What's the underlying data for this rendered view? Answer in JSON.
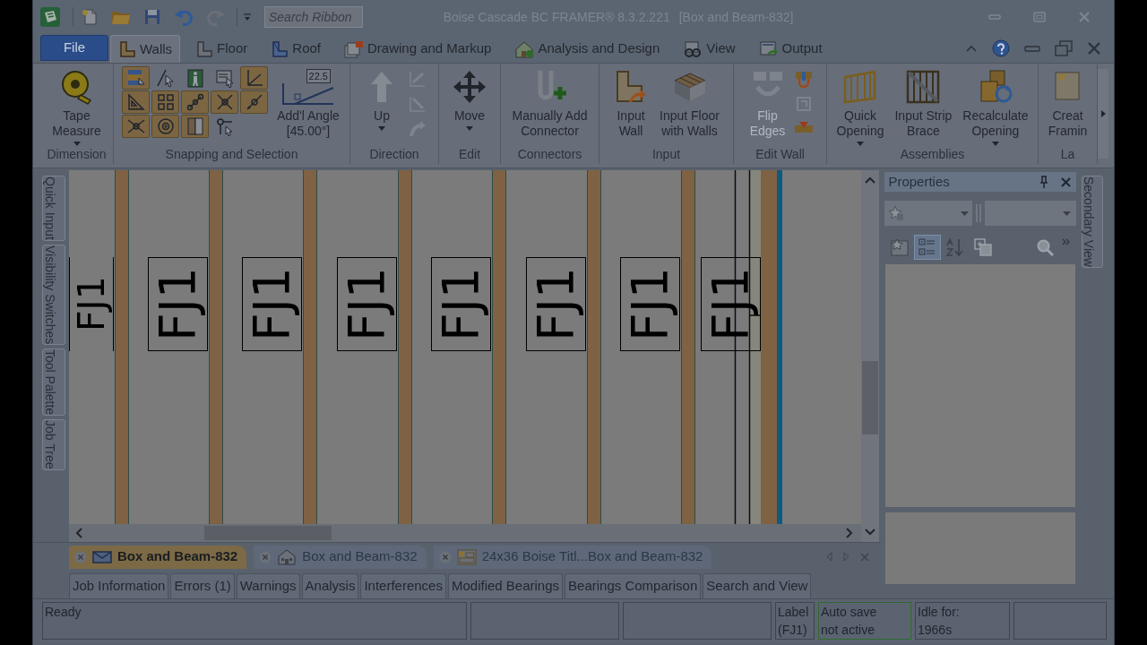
{
  "window": {
    "app_title": "Boise Cascade BC FRAMER® 8.3.2.221",
    "document": "[Box and Beam-832]"
  },
  "quick_access": [
    {
      "disabled": false
    },
    {
      "disabled": false
    },
    {
      "disabled": false
    },
    {
      "disabled": false
    },
    {
      "disabled": true
    }
  ],
  "search": {
    "placeholder": "Search Ribbon"
  },
  "ribbon": {
    "file_menu": "File",
    "tabs": [
      {
        "label": "Walls",
        "selected": true
      },
      {
        "label": "Floor",
        "selected": false
      },
      {
        "label": "Roof",
        "selected": false
      },
      {
        "label": "Drawing and Markup",
        "selected": false
      },
      {
        "label": "Analysis and Design",
        "selected": false
      },
      {
        "label": "View",
        "selected": false
      },
      {
        "label": "Output",
        "selected": false
      }
    ],
    "groups": [
      {
        "label": "Dimension",
        "items": [
          {
            "kind": "large",
            "label": "Tape\nMeasure",
            "dropdown": true,
            "disabled": false
          }
        ]
      },
      {
        "label": "Snapping and Selection",
        "items": [
          {
            "kind": "toggles",
            "toggles": [
              {
                "on": true
              },
              {
                "on": false
              },
              {
                "on": false
              },
              {
                "on": false
              },
              {
                "on": true
              },
              {
                "on": true
              },
              {
                "on": true
              },
              {
                "on": true
              },
              {
                "on": true
              },
              {
                "on": true
              },
              {
                "on": true
              },
              {
                "on": true
              },
              {
                "on": true
              },
              {
                "on": false
              }
            ]
          },
          {
            "kind": "angle",
            "value": "22.5",
            "label": "Add'l Angle\n[45.00°]"
          }
        ]
      },
      {
        "label": "Direction",
        "items": [
          {
            "kind": "large",
            "label": "Up",
            "dropdown": true,
            "disabled": false
          },
          {
            "kind": "small",
            "tools": [
              {
                "disabled": true
              },
              {
                "disabled": true
              },
              {
                "disabled": true
              }
            ]
          }
        ]
      },
      {
        "label": "Edit",
        "items": [
          {
            "kind": "large",
            "label": "Move",
            "dropdown": true,
            "disabled": false
          }
        ]
      },
      {
        "label": "Connectors",
        "items": [
          {
            "kind": "large",
            "label": "Manually Add\nConnector",
            "dropdown": false,
            "disabled": false
          }
        ]
      },
      {
        "label": "Input",
        "items": [
          {
            "kind": "large",
            "label": "Input\nWall",
            "dropdown": false,
            "disabled": false
          },
          {
            "kind": "large",
            "label": "Input Floor\nwith Walls",
            "dropdown": false,
            "disabled": false
          }
        ]
      },
      {
        "label": "Edit Wall",
        "items": [
          {
            "kind": "large",
            "label": "Flip\nEdges",
            "dropdown": false,
            "disabled": true
          },
          {
            "kind": "small",
            "tools": [
              {
                "disabled": false
              },
              {
                "disabled": true
              },
              {
                "disabled": false
              }
            ]
          }
        ]
      },
      {
        "label": "Assemblies",
        "items": [
          {
            "kind": "large",
            "label": "Quick\nOpening",
            "dropdown": true,
            "disabled": false
          },
          {
            "kind": "large",
            "label": "Input Strip\nBrace",
            "dropdown": false,
            "disabled": false
          },
          {
            "kind": "large",
            "label": "Recalculate\nOpening",
            "dropdown": true,
            "disabled": false
          }
        ]
      },
      {
        "label": "La",
        "items": [
          {
            "kind": "large",
            "label": "Creat\nFramin",
            "dropdown": false,
            "disabled": false
          }
        ]
      }
    ]
  },
  "dock_tabs_left": [
    "Quick Input",
    "Visibility Switches",
    "Tool Palette",
    "Job Tree"
  ],
  "canvas": {
    "labels": [
      {
        "text": "FJ1"
      },
      {
        "text": "FJ1"
      },
      {
        "text": "FJ1"
      },
      {
        "text": "FJ1"
      },
      {
        "text": "FJ1"
      },
      {
        "text": "FJ1"
      },
      {
        "text": "FJ1"
      },
      {
        "text": "FJ1"
      }
    ]
  },
  "properties": {
    "title": "Properties",
    "view_buttons": [
      {
        "selected": false
      },
      {
        "selected": true
      },
      {
        "selected": false
      },
      {
        "selected": false
      }
    ]
  },
  "dock_tabs_right": [
    "Secondary View"
  ],
  "document_tabs": [
    {
      "label": "Box and Beam-832",
      "selected": true
    },
    {
      "label": "Box and Beam-832",
      "selected": false
    },
    {
      "label": "24x36 Boise Titl...Box and Beam-832",
      "selected": false
    }
  ],
  "output_tabs": [
    {
      "label": "Job Information",
      "selected": false
    },
    {
      "label": "Errors (1)",
      "selected": false
    },
    {
      "label": "Warnings",
      "selected": false
    },
    {
      "label": "Analysis",
      "selected": false
    },
    {
      "label": "Interferences",
      "selected": false
    },
    {
      "label": "Modified Bearings",
      "selected": false
    },
    {
      "label": "Bearings Comparison",
      "selected": false
    },
    {
      "label": "Search and View",
      "selected": false
    }
  ],
  "status_bar": {
    "panels": [
      {
        "kind": "text",
        "text": "Ready",
        "highlighted": false
      },
      {
        "kind": "empty",
        "highlighted": false
      },
      {
        "kind": "empty",
        "highlighted": false
      },
      {
        "kind": "text",
        "text": "Label\n(FJ1)",
        "highlighted": false
      },
      {
        "kind": "text",
        "text": "Auto save\nnot active",
        "highlighted": true
      },
      {
        "kind": "text",
        "text": "Idle for:\n1966s",
        "highlighted": false
      },
      {
        "kind": "empty",
        "highlighted": false
      }
    ]
  }
}
